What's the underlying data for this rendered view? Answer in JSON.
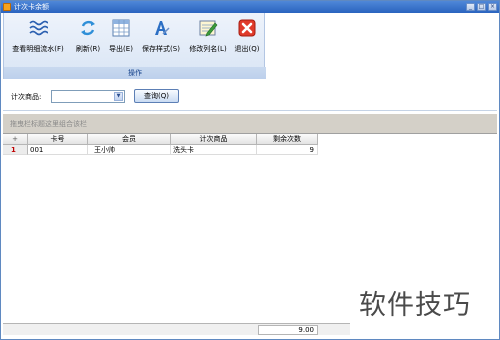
{
  "window": {
    "title": "计次卡余额",
    "controls": [
      "_",
      "□",
      "×"
    ]
  },
  "ribbon": {
    "buttons": [
      {
        "label": "查看明细流水(F)",
        "icon": "detail-flow-icon"
      },
      {
        "label": "刷新(R)",
        "icon": "refresh-icon"
      },
      {
        "label": "导出(E)",
        "icon": "export-icon"
      },
      {
        "label": "保存样式(S)",
        "icon": "save-style-icon"
      },
      {
        "label": "修改列名(L)",
        "icon": "edit-column-icon"
      },
      {
        "label": "退出(Q)",
        "icon": "exit-icon"
      }
    ],
    "group_label": "操作"
  },
  "filter": {
    "label": "计次商品:",
    "value": "",
    "query_button": "查询(Q)"
  },
  "group_panel": {
    "placeholder": "拖曳栏标题这里组合该栏"
  },
  "grid": {
    "corner": "+",
    "columns": [
      "卡号",
      "会员",
      "计次商品",
      "剩余次数"
    ],
    "rows": [
      {
        "indicator": "1",
        "card_no": "001",
        "member": "王小帅",
        "product": "洗头卡",
        "remaining": "9"
      }
    ],
    "footer_total": "9.00"
  },
  "watermark": "软件技巧",
  "colors": {
    "title_bar": "#2a63bf",
    "ribbon_label": "#15428b",
    "row_indicator": "#c00000"
  }
}
